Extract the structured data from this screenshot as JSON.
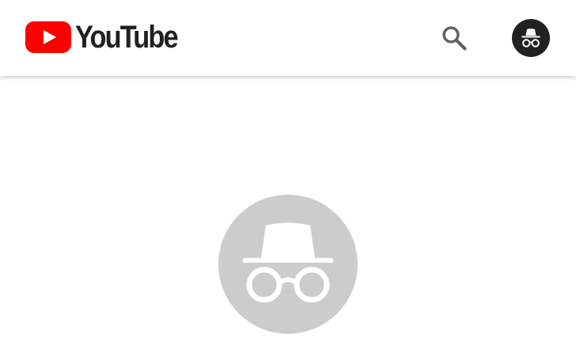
{
  "header": {
    "brand_name": "YouTube",
    "logo_icon": "youtube-play-icon",
    "search_icon": "search-icon",
    "account_icon": "incognito-icon"
  },
  "main": {
    "hero_icon": "incognito-icon"
  },
  "colors": {
    "brand_red": "#ff0000",
    "logo_text": "#212121",
    "icon_grey": "#606060",
    "avatar_bg": "#212121",
    "hero_circle": "#cccccc",
    "background": "#ffffff"
  }
}
